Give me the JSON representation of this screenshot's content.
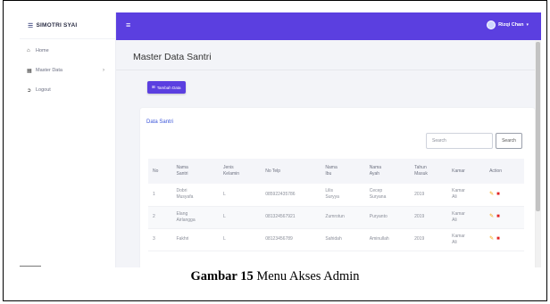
{
  "brand": {
    "name": "SIMOTRI SYAI",
    "logo_icon": "layers-logo"
  },
  "sidebar": {
    "items": [
      {
        "label": "Home",
        "icon": "home-icon"
      },
      {
        "label": "Master Data",
        "icon": "grid-icon",
        "has_submenu": true
      },
      {
        "label": "Logout",
        "icon": "logout-icon"
      }
    ]
  },
  "topbar": {
    "user_name": "Rizqi Chan",
    "accent": "#5b3fe0"
  },
  "page": {
    "title": "Master Data Santri"
  },
  "toolbar": {
    "add_label": "Tambah Data"
  },
  "card": {
    "title": "Data Santri",
    "search_placeholder": "Search",
    "search_button": "Search"
  },
  "table": {
    "headers": [
      "No",
      "Nama\nSantri",
      "Jenis\nKelamin",
      "No Telp",
      "Nama\nIbu",
      "Nama\nAyah",
      "Tahun\nMasuk",
      "Kamar",
      "Action"
    ],
    "rows": [
      [
        "1",
        "Dobri\nMusyafa",
        "L",
        "085922435786",
        "Lilis\nSuryya",
        "Cecep\nSuryana",
        "2019",
        "Kamar\nAli"
      ],
      [
        "2",
        "Elang\nAirlangga",
        "L",
        "081324567921",
        "Zumrotun",
        "Puryanto",
        "2019",
        "Kamar\nAli"
      ],
      [
        "3",
        "Fakhri",
        "L",
        "08123456789",
        "Sahidah",
        "Aminullah",
        "2019",
        "Kamar\nAli"
      ]
    ]
  },
  "caption": {
    "label": "Gambar 15",
    "text": " Menu Akses Admin"
  }
}
